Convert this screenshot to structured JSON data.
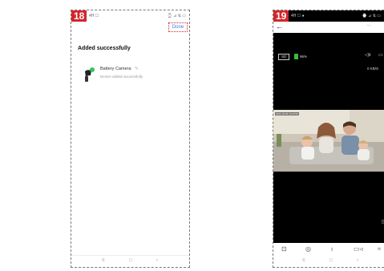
{
  "step18": {
    "badge": "18",
    "status_left": "4H ☐",
    "status_right": "⌚ ⊿ ⇅ ▭",
    "done_label": "Done",
    "heading": "Added successfully",
    "device_name": "Battery Camera",
    "edit_icon": "✎",
    "device_status": "Device added successfully",
    "nav": {
      "menu": "≡",
      "home": "□",
      "back": "‹"
    }
  },
  "step19": {
    "badge": "19",
    "status_left": "4H ☐ ●",
    "status_right": "⌚ ⊿ ⇅ ▭",
    "back_icon": "←",
    "more_icon": "...",
    "sd_label": "SD",
    "battery_pct": "96%",
    "battery_color": "#3bbb3b",
    "mute_icon": "◁x",
    "screen_icon": "▭",
    "speed": "0 KB/S",
    "timestamp": "2021-08-06 10:23:50",
    "side_icon": "▯",
    "controls": {
      "screenshot_fullscreen": "⊡",
      "snapshot": "◎",
      "talk": "♁",
      "record": "▭◃",
      "more": "≈"
    },
    "nav": {
      "menu": "≡",
      "home": "□",
      "back": "‹"
    }
  }
}
